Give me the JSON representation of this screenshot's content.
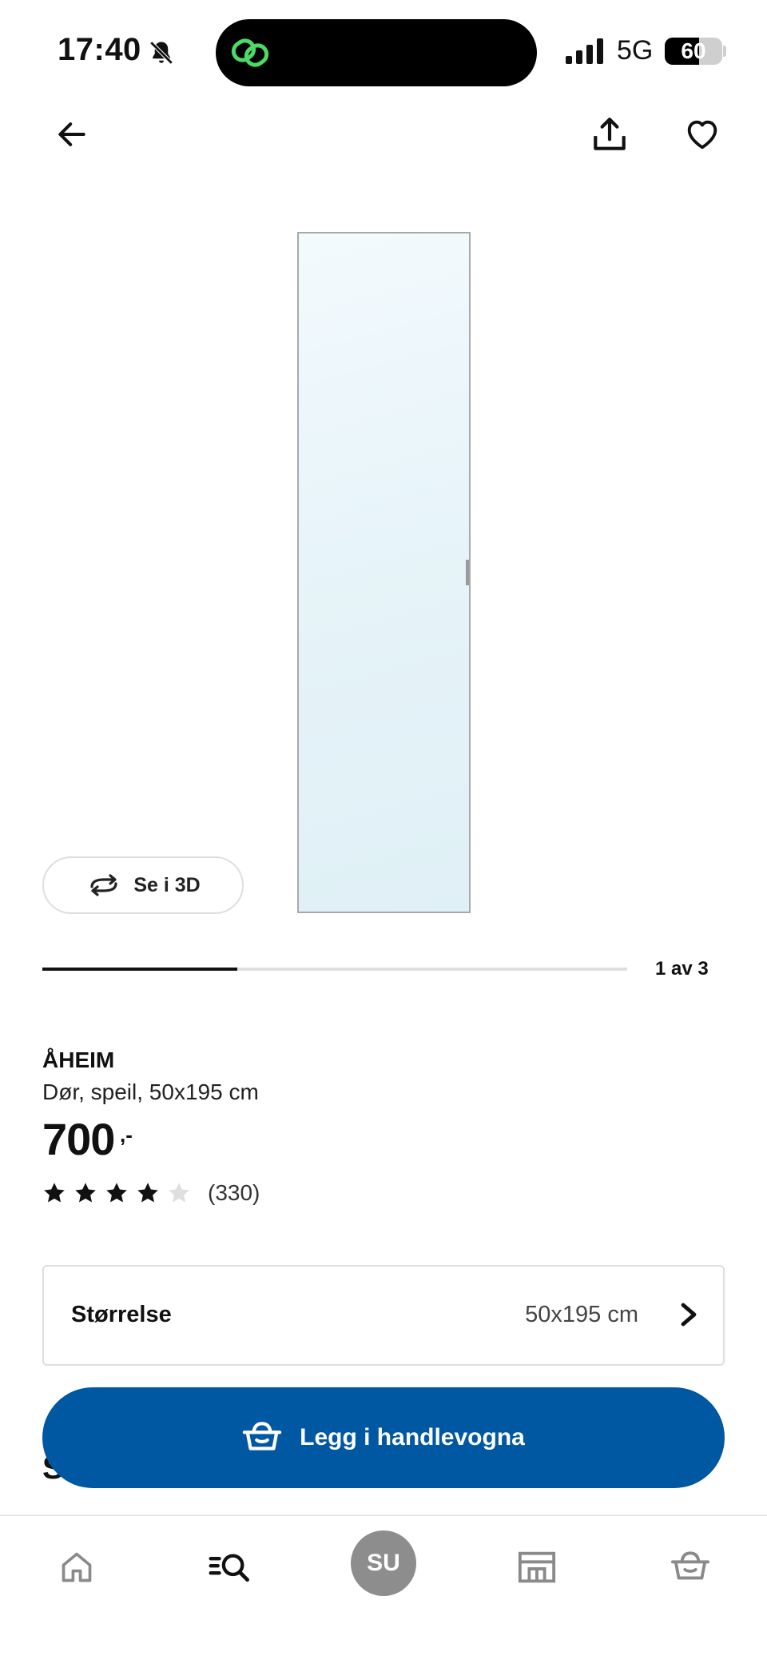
{
  "status_bar": {
    "time": "17:40",
    "network": "5G",
    "battery_level": "60",
    "battery_fraction": 0.6,
    "icons": [
      "bell-muted-icon",
      "signal-icon",
      "battery-icon",
      "island-app-icon"
    ]
  },
  "header": {
    "back_icon": "arrow-left-icon",
    "share_icon": "share-icon",
    "favorite_icon": "heart-icon"
  },
  "gallery": {
    "view_3d_label": "Se i 3D",
    "position_label": "1 av 3",
    "current": 1,
    "total": 3
  },
  "product": {
    "name": "ÅHEIM",
    "description": "Dør, speil, 50x195 cm",
    "price": "700",
    "price_suffix": ",-",
    "rating": 4,
    "rating_max": 5,
    "review_count": "(330)"
  },
  "size_selector": {
    "label": "Størrelse",
    "value": "50x195 cm"
  },
  "section_peek": "Su",
  "cart_button": {
    "label": "Legg i handlevogna",
    "icon": "basket-icon"
  },
  "bottom_nav": {
    "avatar_initials": "SU",
    "items": [
      "home-icon",
      "search-icon",
      "avatar",
      "store-icon",
      "basket-icon"
    ]
  },
  "colors": {
    "primary": "#0058a3",
    "text": "#111111",
    "star_filled": "#111111",
    "star_empty": "#dfdfdf",
    "avatar_bg": "#8d8d8d"
  }
}
